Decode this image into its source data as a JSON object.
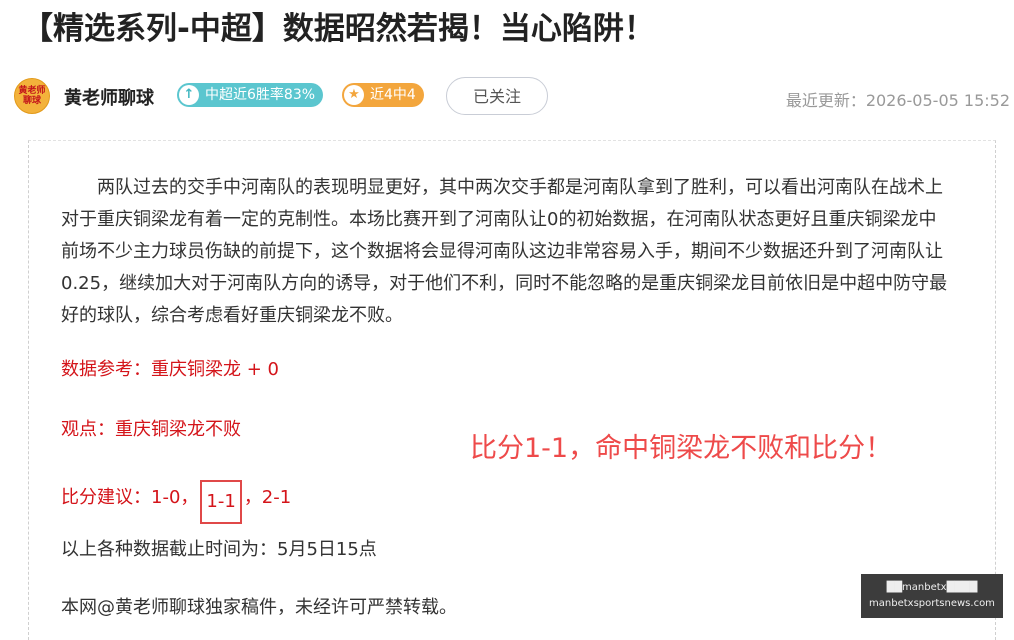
{
  "article": {
    "title": "【精选系列-中超】数据昭然若揭！当心陷阱！",
    "update_label": "最近更新：2026-05-05 15:52"
  },
  "author": {
    "avatar_text_top": "黄老师",
    "avatar_text_bottom": "聊球",
    "name": "黄老师聊球",
    "badge_win": "中超近6胜率83%",
    "badge_recent": "近4中4",
    "follow_label": "已关注"
  },
  "body": {
    "paragraph": "两队过去的交手中河南队的表现明显更好，其中两次交手都是河南队拿到了胜利，可以看出河南队在战术上对于重庆铜梁龙有着一定的克制性。本场比赛开到了河南队让0的初始数据，在河南队状态更好且重庆铜梁龙中前场不少主力球员伤缺的前提下，这个数据将会显得河南队这边非常容易入手，期间不少数据还升到了河南队让0.25，继续加大对于河南队方向的诱导，对于他们不利，同时不能忽略的是重庆铜梁龙目前依旧是中超中防守最好的球队，综合考虑看好重庆铜梁龙不败。",
    "reference": "数据参考：重庆铜梁龙 + 0",
    "viewpoint": "观点：重庆铜梁龙不败",
    "score_prefix": "比分建议：1-0，",
    "score_boxed": "1-1",
    "score_suffix": "，2-1",
    "cutoff": "以上各种数据截止时间为：5月5日15点",
    "copyright": "本网@黄老师聊球独家稿件，未经许可严禁转载。",
    "hit_note": "比分1-1，命中铜梁龙不败和比分！"
  },
  "watermark": {
    "line1": "██manbetx████",
    "line2": "manbetxsportsnews.com"
  }
}
